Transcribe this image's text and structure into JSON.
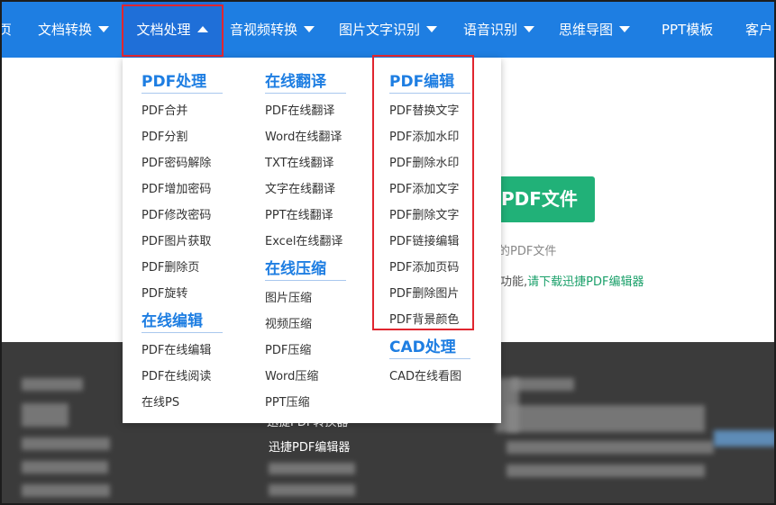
{
  "nav": {
    "items": [
      {
        "label": "页",
        "has_caret": false
      },
      {
        "label": "文档转换",
        "has_caret": true
      },
      {
        "label": "文档处理",
        "has_caret": true,
        "active": true
      },
      {
        "label": "音视频转换",
        "has_caret": true
      },
      {
        "label": "图片文字识别",
        "has_caret": true
      },
      {
        "label": "语音识别",
        "has_caret": true
      },
      {
        "label": "思维导图",
        "has_caret": true
      },
      {
        "label": "PPT模板",
        "has_caret": false
      },
      {
        "label": "客户",
        "has_caret": false
      }
    ],
    "bg_color": "#1e7ee2"
  },
  "dropdown": {
    "columns": [
      {
        "groups": [
          {
            "title": "PDF处理",
            "items": [
              "PDF合并",
              "PDF分割",
              "PDF密码解除",
              "PDF增加密码",
              "PDF修改密码",
              "PDF图片获取",
              "PDF删除页",
              "PDF旋转"
            ]
          },
          {
            "title": "在线编辑",
            "items": [
              "PDF在线编辑",
              "PDF在线阅读",
              "在线PS"
            ]
          }
        ]
      },
      {
        "groups": [
          {
            "title": "在线翻译",
            "items": [
              "PDF在线翻译",
              "Word在线翻译",
              "TXT在线翻译",
              "文字在线翻译",
              "PPT在线翻译",
              "Excel在线翻译"
            ]
          },
          {
            "title": "在线压缩",
            "items": [
              "图片压缩",
              "视频压缩",
              "PDF压缩",
              "Word压缩",
              "PPT压缩"
            ]
          }
        ]
      },
      {
        "groups": [
          {
            "title": "PDF编辑",
            "items": [
              "PDF替换文字",
              "PDF添加水印",
              "PDF删除水印",
              "PDF添加文字",
              "PDF删除文字",
              "PDF链接编辑",
              "PDF添加页码",
              "PDF删除图片",
              "PDF背景颜色"
            ]
          },
          {
            "title": "CAD处理",
            "items": [
              "CAD在线看图"
            ]
          }
        ]
      }
    ],
    "accent_color": "#1e7ee2"
  },
  "background": {
    "button_label": "PDF文件",
    "grey_text": "的PDF文件",
    "hint_prefix": "功能,",
    "hint_link": "请下载迅捷PDF编辑器",
    "button_color": "#21b178",
    "link_color": "#1aa06a"
  },
  "footer": {
    "link_partial": "迅捷PDF转换器",
    "link": "迅捷PDF编辑器"
  },
  "highlight_color": "#e0262f"
}
